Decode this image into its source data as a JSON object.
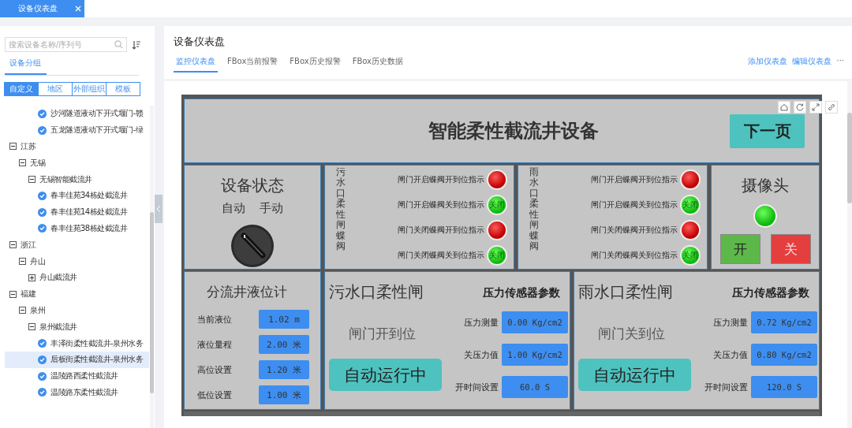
{
  "top_tabs": [
    {
      "label": "设备仪表盘",
      "selected": true,
      "closable": true
    }
  ],
  "sidebar": {
    "search": {
      "placeholder": "搜索设备名称/序列号"
    },
    "group_tab": "设备分组",
    "filters": [
      {
        "label": "自定义",
        "selected": true
      },
      {
        "label": "地区",
        "selected": false
      },
      {
        "label": "外部组织",
        "selected": false
      },
      {
        "label": "模板",
        "selected": false
      }
    ],
    "tree": [
      {
        "kind": "device",
        "label": "沙河隧道液动下开式堰门-赣",
        "selected": false
      },
      {
        "kind": "device",
        "label": "五龙隧道液动下开式堰门-绿",
        "selected": false
      },
      {
        "kind": "group",
        "label": "江苏",
        "expanded": true,
        "children": [
          {
            "kind": "group",
            "label": "无锡",
            "expanded": true,
            "children": [
              {
                "kind": "group",
                "label": "无锡智能截流井",
                "expanded": true,
                "children": [
                  {
                    "kind": "device",
                    "label": "春丰佳苑34栋处截流井",
                    "selected": false
                  },
                  {
                    "kind": "device",
                    "label": "春丰佳苑14栋处截流井",
                    "selected": false
                  },
                  {
                    "kind": "device",
                    "label": "春丰佳苑38栋处截流井",
                    "selected": false
                  }
                ]
              }
            ]
          }
        ]
      },
      {
        "kind": "group",
        "label": "浙江",
        "expanded": true,
        "children": [
          {
            "kind": "group",
            "label": "舟山",
            "expanded": true,
            "children": [
              {
                "kind": "group",
                "label": "舟山截流井",
                "expanded": false
              }
            ]
          }
        ]
      },
      {
        "kind": "group",
        "label": "福建",
        "expanded": true,
        "children": [
          {
            "kind": "group",
            "label": "泉州",
            "expanded": true,
            "children": [
              {
                "kind": "group",
                "label": "泉州截流井",
                "expanded": true,
                "children": [
                  {
                    "kind": "device",
                    "label": "丰泽街柔性截流井-泉州水务",
                    "selected": false
                  },
                  {
                    "kind": "device",
                    "label": "后板街柔性截流井-泉州水务",
                    "selected": true
                  },
                  {
                    "kind": "device",
                    "label": "温陵路西柔性截流井",
                    "selected": false
                  },
                  {
                    "kind": "device",
                    "label": "温陵路东柔性截流井",
                    "selected": false
                  }
                ]
              }
            ]
          }
        ]
      }
    ]
  },
  "header": {
    "title": "设备仪表盘",
    "tabs": [
      {
        "label": "监控仪表盘",
        "selected": true
      },
      {
        "label": "FBox当前报警",
        "selected": false
      },
      {
        "label": "FBox历史报警",
        "selected": false
      },
      {
        "label": "FBox历史数据",
        "selected": false
      }
    ],
    "actions": [
      "添加仪表盘",
      "编辑仪表盘"
    ],
    "more": "···"
  },
  "hmi": {
    "title": "智能柔性截流井设备",
    "next_button": "下一页",
    "status": {
      "title": "设备状态",
      "modes": [
        "自动",
        "手动"
      ]
    },
    "valves": [
      {
        "label": "污水口柔性闸蝶阀",
        "indicators": [
          {
            "label": "闸门开启蝶阀开到位指示",
            "open": true
          },
          {
            "label": "闸门开启蝶阀关到位指示",
            "open": false,
            "text": "关闭"
          },
          {
            "label": "闸门关闭蝶阀开到位指示",
            "open": true
          },
          {
            "label": "闸门关闭蝶阀关到位指示",
            "open": false,
            "text": "关闭"
          }
        ]
      },
      {
        "label": "雨水口柔性闸蝶阀",
        "indicators": [
          {
            "label": "闸门开启蝶阀开到位指示",
            "open": true
          },
          {
            "label": "闸门开启蝶阀关到位指示",
            "open": false,
            "text": "关闭"
          },
          {
            "label": "闸门关闭蝶阀开到位指示",
            "open": true
          },
          {
            "label": "闸门关闭蝶阀关到位指示",
            "open": false,
            "text": "关闭"
          }
        ]
      }
    ],
    "camera": {
      "title": "摄像头",
      "on": true,
      "buttons": [
        {
          "kind": "on",
          "label": "开"
        },
        {
          "kind": "off",
          "label": "关"
        }
      ]
    },
    "level": {
      "title": "分流井液位计",
      "rows": [
        {
          "label": "当前液位",
          "value": "1.02 m"
        },
        {
          "label": "液位量程",
          "value": "2.00 米"
        },
        {
          "label": "高位设置",
          "value": "1.20 米"
        },
        {
          "label": "低位设置",
          "value": "1.00 米"
        }
      ]
    },
    "gates": [
      {
        "title": "污水口柔性闸",
        "params_title": "压力传感器参数",
        "status": "闸门开到位",
        "mode": "自动运行中",
        "params": [
          {
            "label": "压力测量",
            "value": "0.00 Kg/cm2"
          },
          {
            "label": "关压力值",
            "value": "1.00 Kg/cm2"
          },
          {
            "label": "开时间设置",
            "value": "60.0 S"
          }
        ]
      },
      {
        "title": "雨水口柔性闸",
        "params_title": "压力传感器参数",
        "status": "闸门关到位",
        "mode": "自动运行中",
        "params": [
          {
            "label": "压力测量",
            "value": "0.72 Kg/cm2"
          },
          {
            "label": "关压力值",
            "value": "0.80 Kg/cm2"
          },
          {
            "label": "开时间设置",
            "value": "120.0 S"
          }
        ]
      }
    ]
  }
}
